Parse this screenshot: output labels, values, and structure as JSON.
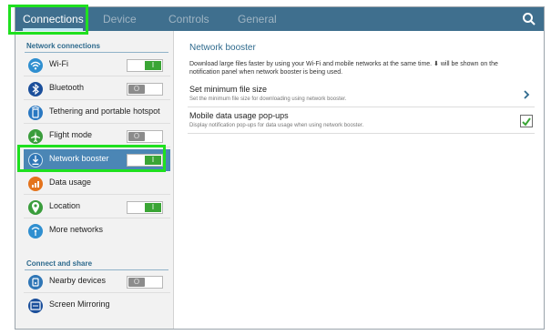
{
  "tabs": [
    {
      "label": "Connections",
      "active": true
    },
    {
      "label": "Device",
      "active": false
    },
    {
      "label": "Controls",
      "active": false
    },
    {
      "label": "General",
      "active": false
    }
  ],
  "search_icon": "search-icon",
  "sidebar": {
    "section1": "Network connections",
    "section2": "Connect and share",
    "items": [
      {
        "label": "Wi-Fi",
        "icon": "wifi-icon",
        "color": "#2f8fd0",
        "toggle": "on",
        "knob": "I"
      },
      {
        "label": "Bluetooth",
        "icon": "bluetooth-icon",
        "color": "#1b4f9b",
        "toggle": "off",
        "knob": "O"
      },
      {
        "label": "Tethering and portable hotspot",
        "icon": "tethering-icon",
        "color": "#2a78c2",
        "toggle": null
      },
      {
        "label": "Flight mode",
        "icon": "airplane-icon",
        "color": "#3a9d3c",
        "toggle": "off",
        "knob": "O"
      },
      {
        "label": "Network booster",
        "icon": "network-booster-icon",
        "color": "#2f76b6",
        "toggle": "on",
        "knob": "I",
        "selected": true
      },
      {
        "label": "Data usage",
        "icon": "data-usage-icon",
        "color": "#e4731c",
        "toggle": null
      },
      {
        "label": "Location",
        "icon": "location-icon",
        "color": "#3a9d3c",
        "toggle": "on",
        "knob": "I"
      },
      {
        "label": "More networks",
        "icon": "more-networks-icon",
        "color": "#2f8fd0",
        "toggle": null
      },
      {
        "label": "Nearby devices",
        "icon": "nearby-devices-icon",
        "color": "#2f76b6",
        "toggle": "off",
        "knob": "O"
      },
      {
        "label": "Screen Mirroring",
        "icon": "screen-mirroring-icon",
        "color": "#1b4f9b",
        "toggle": null
      }
    ]
  },
  "content": {
    "title": "Network booster",
    "description": "Download large files faster by using your Wi-Fi and mobile networks at the same time. ⬇ will be shown on the notification panel when network booster is being used.",
    "rows": [
      {
        "title": "Set minimum file size",
        "subtitle": "Set the minimum file size for downloading using network booster.",
        "control": "chevron"
      },
      {
        "title": "Mobile data usage pop-ups",
        "subtitle": "Display notification pop-ups for data usage when using network booster.",
        "control": "checkbox",
        "checked": true
      }
    ]
  },
  "colors": {
    "topbar": "#3f6f8e",
    "accent": "#2e6a8d",
    "selected": "#4b86b5",
    "toggle_on": "#3aa535",
    "highlight": "#1fe01f"
  }
}
